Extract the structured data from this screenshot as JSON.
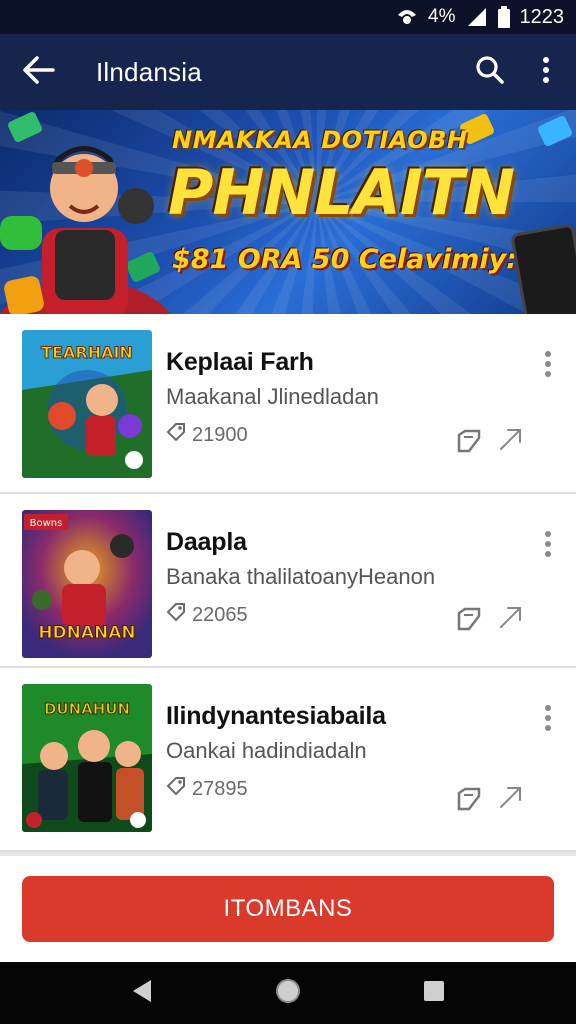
{
  "status_bar": {
    "battery_text": "4%",
    "time": "1223"
  },
  "app_bar": {
    "title": "Ilndansia"
  },
  "banner": {
    "headline_small": "NMAKKAA DOTIAOBH",
    "headline_big": "PHNLAITN",
    "headline_sub": "$81 ORA 50 Celavimiy:al"
  },
  "items": [
    {
      "name": "Keplaai Farh",
      "description": "Maakanal Jlinedladan",
      "count": "21900",
      "thumb_title": "TEARHAIN",
      "thumb_colors": [
        "#2a9fd6",
        "#1f6f2a",
        "#e04a2a"
      ]
    },
    {
      "name": "Daapla",
      "description": "Banaka thalilatoanyHeanon",
      "count": "22065",
      "thumb_title": "HDNANAN",
      "thumb_badge": "Bowns",
      "thumb_colors": [
        "#3a2a7a",
        "#8a2a6a",
        "#e6a21a"
      ]
    },
    {
      "name": "Ilindynantesiabaila",
      "description": "Oankai hadindiadaln",
      "count": "27895",
      "thumb_title": "DUNAHUN",
      "thumb_colors": [
        "#1f8a2a",
        "#0e4a1a",
        "#e6d21a"
      ]
    }
  ],
  "cta": {
    "label": "ITOMBANS"
  },
  "colors": {
    "app_bar": "#16254d",
    "status_bar": "#0a1128",
    "cta": "#d93a2b"
  },
  "icons": [
    "back-arrow-icon",
    "search-icon",
    "more-vert-icon",
    "tag-icon",
    "edit-icon",
    "share-icon",
    "back-triangle-icon",
    "home-circle-icon",
    "recents-square-icon"
  ]
}
